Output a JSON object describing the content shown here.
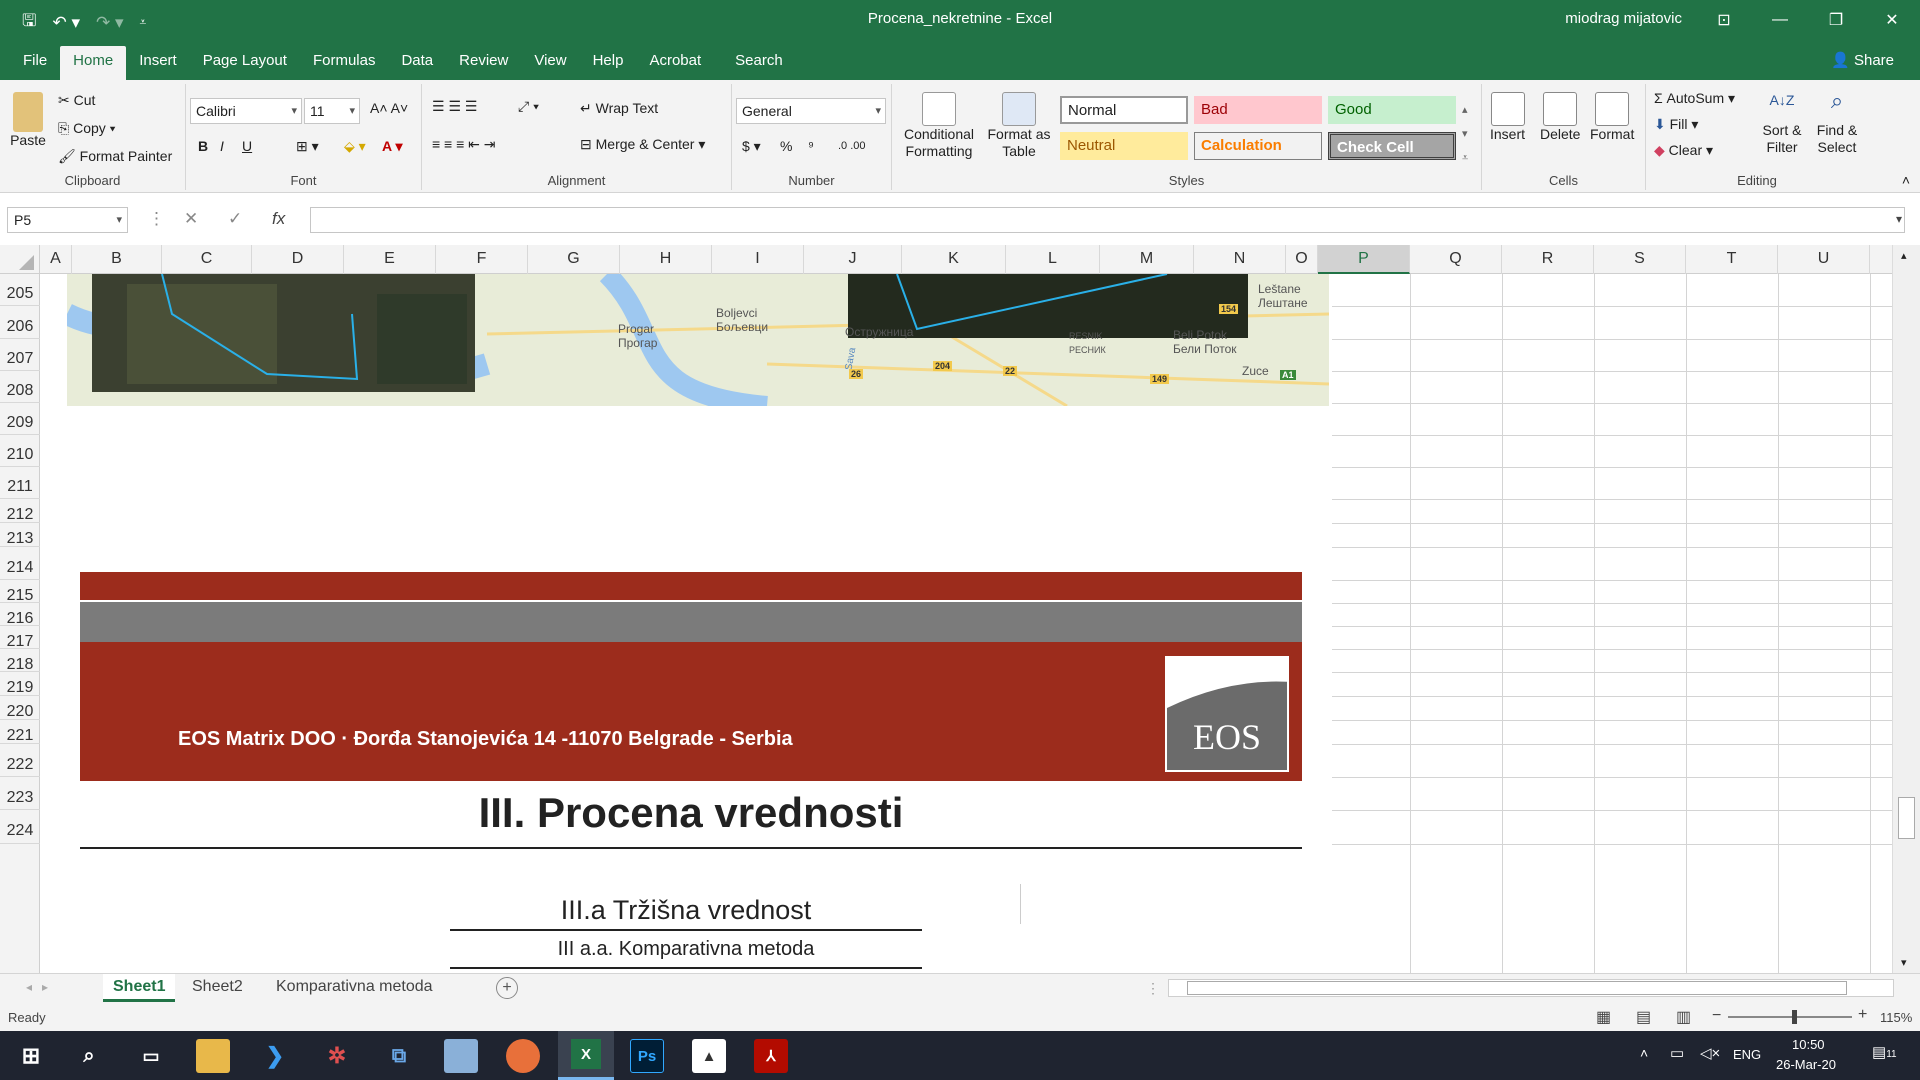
{
  "window": {
    "title": "Procena_nekretnine  -  Excel",
    "user": "miodrag mijatovic"
  },
  "menu": {
    "tabs": [
      "File",
      "Home",
      "Insert",
      "Page Layout",
      "Formulas",
      "Data",
      "Review",
      "View",
      "Help",
      "Acrobat",
      "Search"
    ],
    "share": "Share"
  },
  "ribbon": {
    "clipboard": {
      "paste": "Paste",
      "cut": "Cut",
      "copy": "Copy",
      "format_painter": "Format Painter",
      "label": "Clipboard"
    },
    "font": {
      "name": "Calibri",
      "size": "11",
      "label": "Font",
      "bold": "B",
      "italic": "I",
      "underline": "U"
    },
    "alignment": {
      "wrap": "Wrap Text",
      "merge": "Merge & Center",
      "label": "Alignment"
    },
    "number": {
      "format": "General",
      "label": "Number",
      "dollar": "$",
      "percent": "%",
      "comma": "⁹",
      "inc_dec": ".0 .00"
    },
    "styles": {
      "conditional": "Conditional Formatting",
      "format_table": "Format as Table",
      "normal": "Normal",
      "bad": "Bad",
      "good": "Good",
      "neutral": "Neutral",
      "calculation": "Calculation",
      "check": "Check Cell",
      "label": "Styles"
    },
    "cells": {
      "insert": "Insert",
      "delete": "Delete",
      "format": "Format",
      "label": "Cells"
    },
    "editing": {
      "autosum": "AutoSum",
      "fill": "Fill",
      "clear": "Clear",
      "sort": "Sort & Filter",
      "find": "Find & Select",
      "label": "Editing"
    }
  },
  "formula_bar": {
    "namebox": "P5",
    "fx": "fx",
    "cancel": "✕",
    "enter": "✓"
  },
  "columns": [
    "A",
    "B",
    "C",
    "D",
    "E",
    "F",
    "G",
    "H",
    "I",
    "J",
    "K",
    "L",
    "M",
    "N",
    "O",
    "P",
    "Q",
    "R",
    "S",
    "T",
    "U"
  ],
  "rows": [
    "205",
    "206",
    "207",
    "208",
    "209",
    "210",
    "211",
    "212",
    "213",
    "214",
    "215",
    "216",
    "217",
    "218",
    "219",
    "220",
    "221",
    "222",
    "223",
    "224"
  ],
  "map": {
    "labels": [
      {
        "t": "Progar\nПрогар"
      },
      {
        "t": "Boljevci\nБољевци"
      },
      {
        "t": "Leštane\nЛештане"
      },
      {
        "t": "Остружница"
      },
      {
        "t": "RESNIK\nРЕСНИК"
      },
      {
        "t": "Beli Potok\nБели Поток"
      },
      {
        "t": "Zuce"
      },
      {
        "t": "Sava"
      }
    ],
    "roads": [
      "154",
      "204",
      "22",
      "26",
      "149",
      "A1"
    ]
  },
  "banner": {
    "company": "EOS Matrix DOO · Đorđa Stanojevića 14 -11070 Belgrade - Serbia",
    "logo": "EOS"
  },
  "headings": {
    "section": "III. Procena vrednosti",
    "sub": "III.a  Tržišna vrednost",
    "subsub": "III a.a. Komparativna metoda"
  },
  "sheets": [
    "Sheet1",
    "Sheet2",
    "Komparativna metoda"
  ],
  "status": {
    "ready": "Ready",
    "zoom": "115%"
  },
  "taskbar": {
    "lang": "ENG",
    "time": "10:50",
    "date": "26-Mar-20",
    "notif": "11"
  }
}
